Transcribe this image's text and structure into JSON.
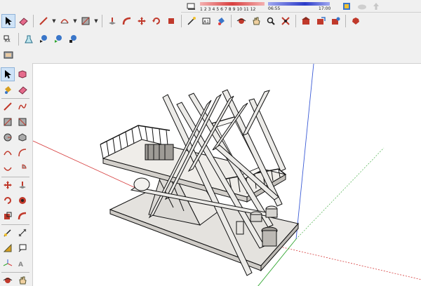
{
  "shadow_settings": {
    "months": [
      "1",
      "2",
      "3",
      "4",
      "5",
      "6",
      "7",
      "8",
      "9",
      "10",
      "11",
      "12"
    ],
    "time_start": "06:55",
    "time_end": "17:00"
  },
  "icons": {
    "row1": [
      "select-arrow-icon",
      "eraser-icon",
      "pencil-line-icon",
      "arc-icon",
      "rectangle-icon",
      "push-pull-icon",
      "follow-me-icon",
      "move-icon",
      "rotate-icon",
      "tape-measure-icon",
      "dimension-icon",
      "paint-bucket-icon",
      "orbit-icon",
      "pan-icon",
      "zoom-icon",
      "zoom-extents-icon",
      "warehouse-icon",
      "share-model-icon",
      "extension-warehouse-icon",
      "ruby-icon"
    ],
    "row2": [
      "select-arrow-icon"
    ],
    "row3": [
      "components-icon"
    ],
    "row4": [
      "sandbox-icon"
    ],
    "row2b": [
      "flask-icon",
      "scene-prev-icon",
      "scene-play-icon",
      "scene-next-icon"
    ]
  },
  "colors": {
    "red_axis": "#d63b3b",
    "green_axis": "#2ea52e",
    "blue_axis": "#3b5bd6",
    "model_face": "#e9e7e4",
    "model_edge": "#111111"
  }
}
